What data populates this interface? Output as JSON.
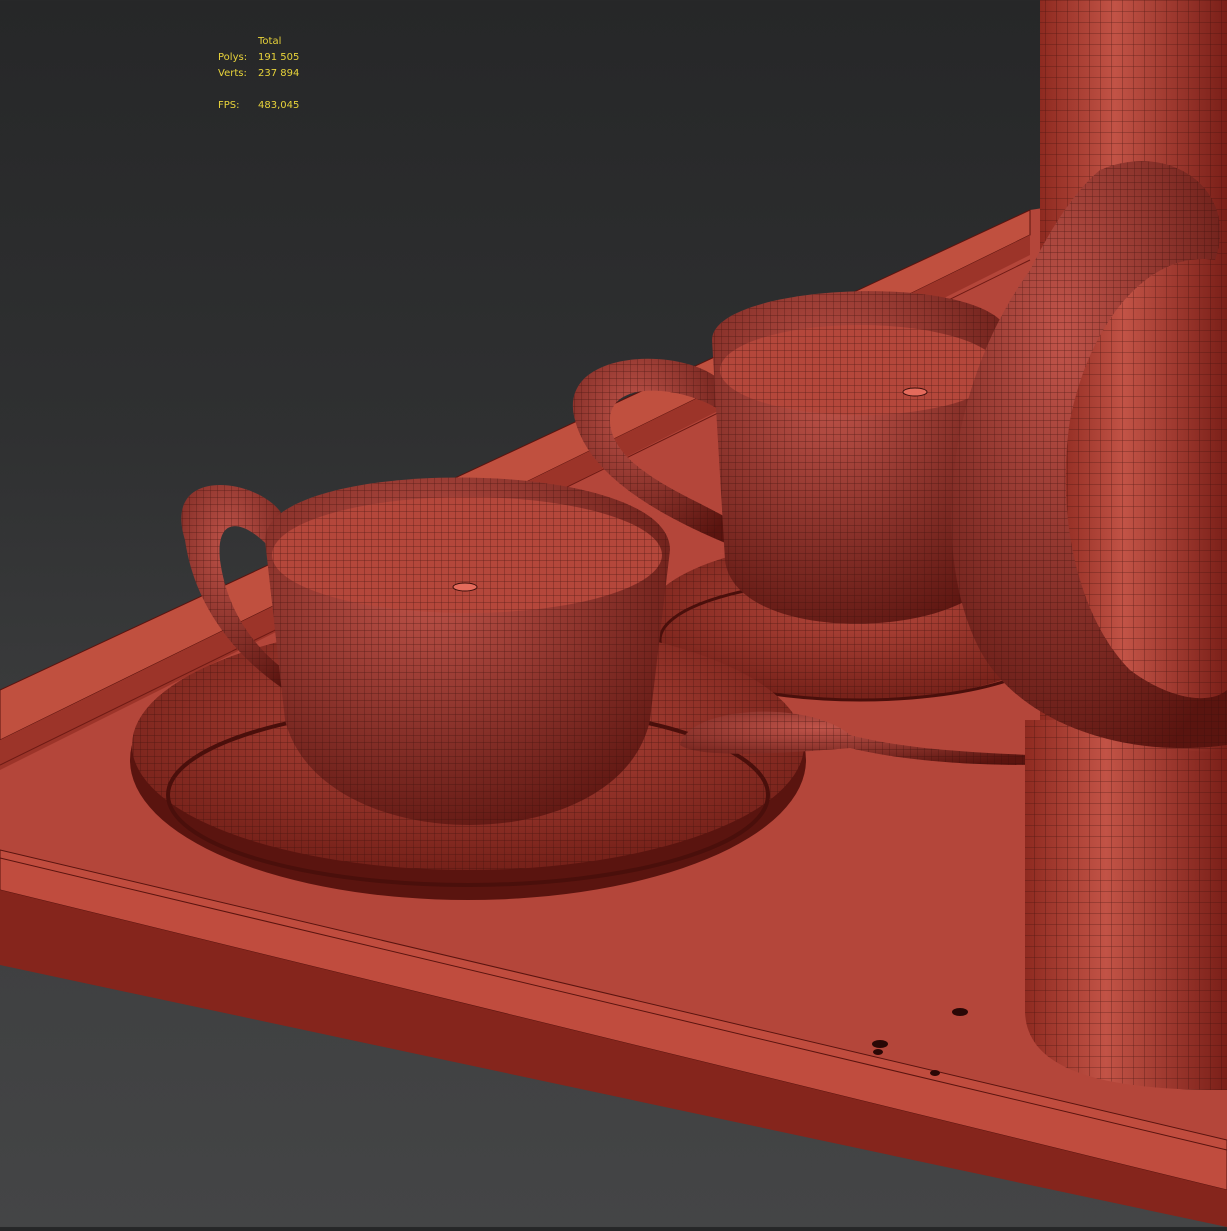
{
  "viewport": {
    "stats": {
      "header": "Total",
      "polys_label": "Polys:",
      "polys_value": "191 505",
      "verts_label": "Verts:",
      "verts_value": "237 894",
      "fps_label": "FPS:",
      "fps_value": "483,045"
    },
    "colors": {
      "background": "#2b2c2d",
      "stats_text": "#e8d33a",
      "model_fill": "#b5473a",
      "model_shadow": "#6e1a14",
      "wireframe": "#3a0e0a"
    }
  }
}
